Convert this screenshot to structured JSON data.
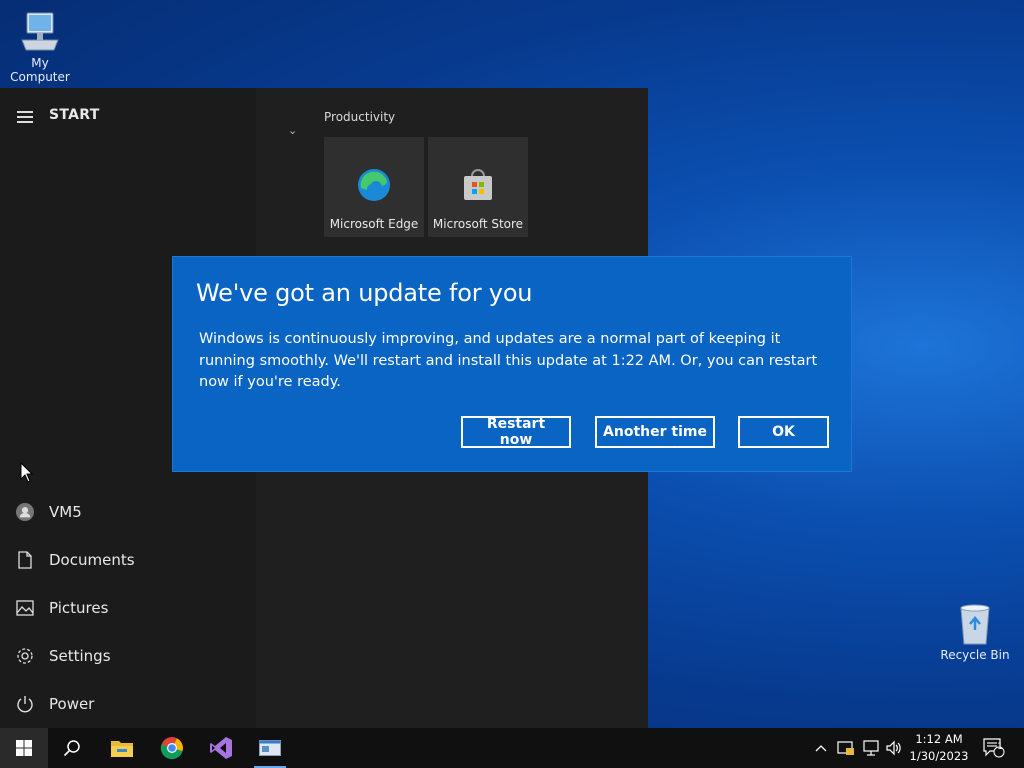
{
  "desktop": {
    "icons": [
      {
        "label": "My Computer"
      },
      {
        "label": "Recycle Bin"
      }
    ]
  },
  "start_menu": {
    "title": "START",
    "group_label": "Productivity",
    "tiles": [
      {
        "label": "Microsoft Edge",
        "icon": "edge-icon"
      },
      {
        "label": "Microsoft Store",
        "icon": "store-icon"
      }
    ],
    "left_items": [
      {
        "label": "VM5",
        "icon": "user-icon"
      },
      {
        "label": "Documents",
        "icon": "document-icon"
      },
      {
        "label": "Pictures",
        "icon": "pictures-icon"
      },
      {
        "label": "Settings",
        "icon": "gear-icon"
      },
      {
        "label": "Power",
        "icon": "power-icon"
      }
    ]
  },
  "dialog": {
    "title": "We've got an update for you",
    "body": "Windows is continuously improving, and updates are a normal part of keeping it running smoothly. We'll restart and install this update at 1:22 AM. Or, you can restart now if you're ready.",
    "buttons": {
      "restart_now": "Restart now",
      "another_time": "Another time",
      "ok": "OK"
    }
  },
  "taskbar": {
    "apps": [
      "windows-start-icon",
      "search-icon",
      "file-explorer-icon",
      "chrome-icon",
      "visual-studio-icon",
      "app-window-icon"
    ],
    "clock": {
      "time": "1:12 AM",
      "date": "1/30/2023"
    },
    "notification_count": "1"
  },
  "colors": {
    "dialog_bg": "#0a64c4",
    "start_bg": "#1f1f1f",
    "taskbar_bg": "#101010",
    "desktop_bg": "#0b4fb0"
  }
}
